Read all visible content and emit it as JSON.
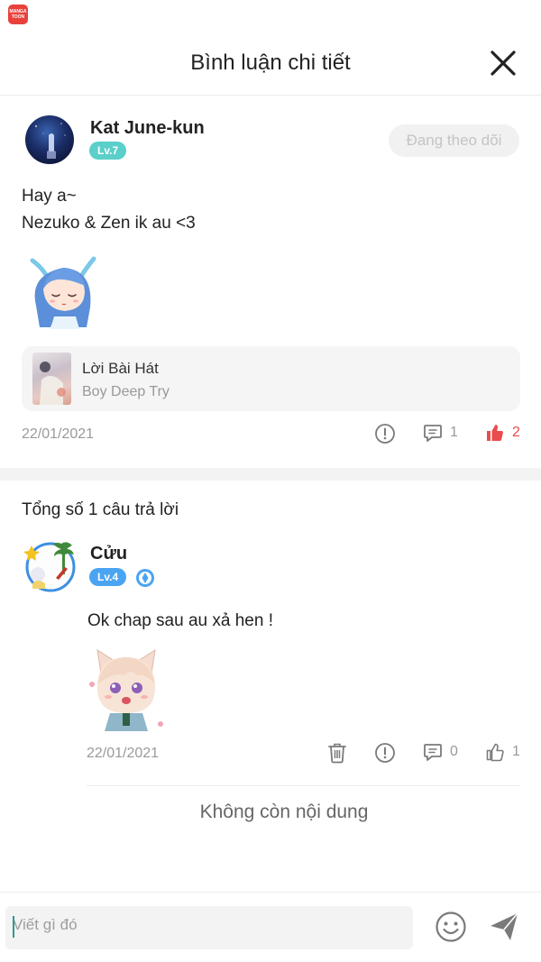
{
  "app_badge": "MANGA TOON",
  "header": {
    "title": "Bình luận chi tiết"
  },
  "main_comment": {
    "user_name": "Kat June-kun",
    "level": "Lv.7",
    "follow_label": "Đang theo dõi",
    "text_lines": [
      "Hay a~",
      "Nezuko & Zen ik au <3"
    ],
    "linked_work": {
      "title": "Lời Bài Hát",
      "subtitle": "Boy Deep Try"
    },
    "date": "22/01/2021",
    "reply_count": "1",
    "like_count": "2"
  },
  "replies": {
    "count_label": "Tổng số 1 câu trả lời",
    "items": [
      {
        "user_name": "Cửu",
        "level": "Lv.4",
        "text": "Ok chap sau au xả hen !",
        "date": "22/01/2021",
        "reply_count": "0",
        "like_count": "1"
      }
    ],
    "end_label": "Không còn nội dung"
  },
  "composer": {
    "placeholder": "Viết gì đó"
  },
  "colors": {
    "like_active": "#ea4b4b",
    "level_teal": "#5bcfc9",
    "level_blue": "#4aa4f2"
  },
  "icons": [
    "close-icon",
    "report-icon",
    "comment-icon",
    "thumbs-up-icon",
    "trash-icon",
    "emoji-icon",
    "send-icon",
    "verified-badge-icon"
  ]
}
